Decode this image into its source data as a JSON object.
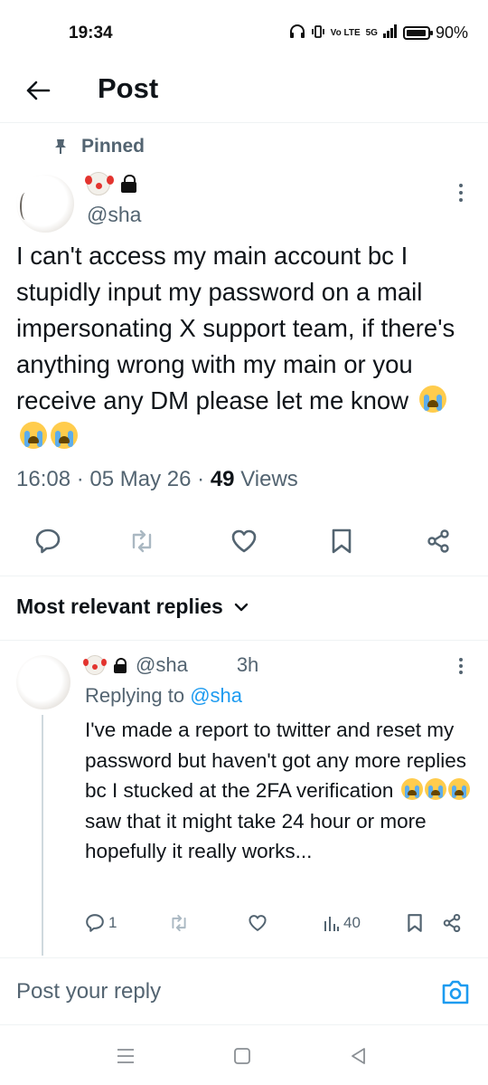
{
  "status_bar": {
    "time": "19:34",
    "network": "Vo LTE",
    "signal": "5G",
    "battery": "90%"
  },
  "header": {
    "title": "Post"
  },
  "post": {
    "pinned_label": "Pinned",
    "handle": "@sha",
    "text": "I can't access my main account bc I stupidly input my password on a mail impersonating X support team, if there's anything wrong with my main or you receive any DM please let me know",
    "time": "16:08",
    "date": "05 May 26",
    "views_count": "49",
    "views_label": "Views"
  },
  "replies_filter": {
    "label": "Most relevant replies"
  },
  "reply": {
    "handle": "@sha",
    "time": "3h",
    "replying_to_label": "Replying to",
    "replying_to_handle": "@sha",
    "text_part1": "I've made a report to twitter and reset my password but haven't got any more replies bc I stucked at the 2FA verification",
    "text_part2": "saw that it might take 24 hour or more hopefully it really works...",
    "reply_count": "1",
    "view_count": "40"
  },
  "composer": {
    "placeholder": "Post your reply"
  },
  "colors": {
    "accent": "#1d9bf0",
    "secondary_text": "#536471",
    "primary_text": "#0f1419"
  }
}
